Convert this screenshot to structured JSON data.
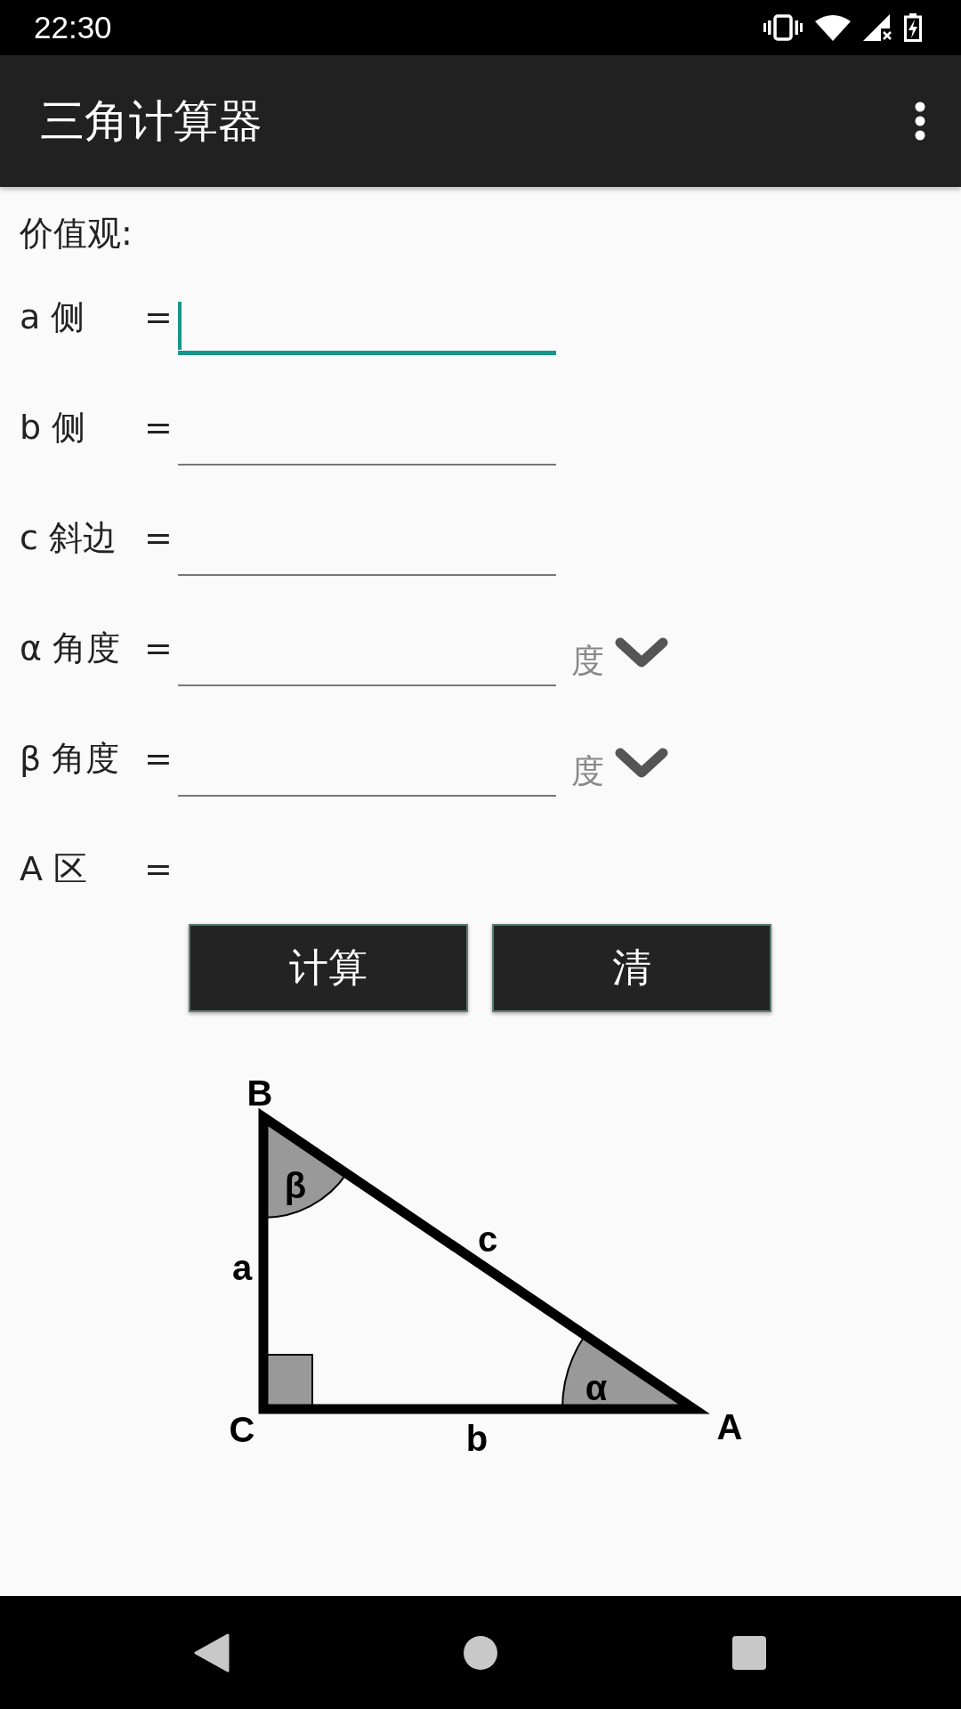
{
  "status_bar": {
    "time": "22:30"
  },
  "app_bar": {
    "title": "三角计算器"
  },
  "section_label": "价值观:",
  "rows": [
    {
      "kind": "input",
      "label": "a 侧",
      "equals": "=",
      "focused": true
    },
    {
      "kind": "input",
      "label": "b 侧",
      "equals": "=",
      "focused": false
    },
    {
      "kind": "input",
      "label": "c 斜边",
      "equals": "=",
      "focused": false
    },
    {
      "kind": "angle",
      "label": "α 角度",
      "equals": "=",
      "focused": false,
      "unit": "度"
    },
    {
      "kind": "angle",
      "label": "β 角度",
      "equals": "=",
      "focused": false,
      "unit": "度"
    },
    {
      "kind": "output",
      "label": "A 区",
      "equals": "="
    }
  ],
  "buttons": [
    "计算",
    "清"
  ],
  "diagram": {
    "vertices": [
      "B",
      "C",
      "A"
    ],
    "sides": [
      "a",
      "b",
      "c"
    ],
    "angles": [
      "β",
      "α"
    ]
  }
}
